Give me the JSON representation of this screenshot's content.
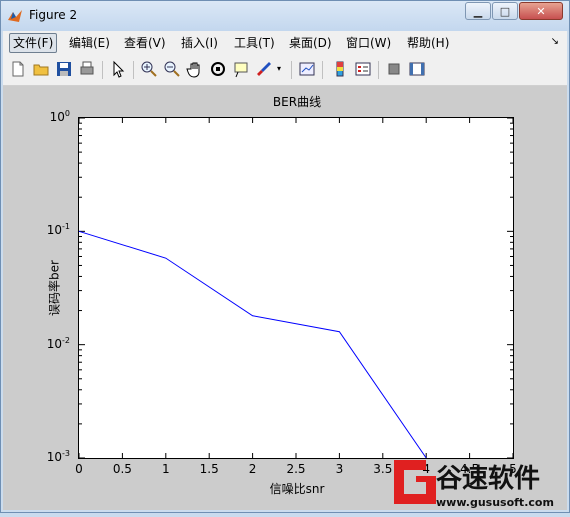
{
  "window": {
    "title": "Figure 2",
    "min_icon": "minimize-icon",
    "max_icon": "maximize-icon",
    "close_icon": "close-icon"
  },
  "menu": [
    {
      "label": "文件(F)",
      "active": true
    },
    {
      "label": "编辑(E)"
    },
    {
      "label": "查看(V)"
    },
    {
      "label": "插入(I)"
    },
    {
      "label": "工具(T)"
    },
    {
      "label": "桌面(D)"
    },
    {
      "label": "窗口(W)"
    },
    {
      "label": "帮助(H)"
    }
  ],
  "toolbar": [
    "new-file-icon",
    "open-folder-icon",
    "save-icon",
    "print-icon",
    "pointer-icon",
    "zoom-in-icon",
    "zoom-out-icon",
    "pan-hand-icon",
    "rotate-3d-icon",
    "data-cursor-icon",
    "brush-icon",
    "link-plot-icon",
    "colorbar-icon",
    "legend-icon",
    "hide-plot-tools-icon",
    "show-plot-tools-icon"
  ],
  "chart_data": {
    "type": "line",
    "title": "BER曲线",
    "xlabel": "信噪比snr",
    "ylabel": "误码率ber",
    "xlim": [
      0,
      5
    ],
    "ylim": [
      0.001,
      1
    ],
    "yscale": "log",
    "grid": false,
    "x": [
      0,
      1,
      2,
      3,
      4
    ],
    "series": [
      {
        "values": [
          0.1,
          0.058,
          0.018,
          0.013,
          0.001
        ],
        "color": "#0000ff"
      }
    ],
    "xticks": [
      "0",
      "0.5",
      "1",
      "1.5",
      "2",
      "2.5",
      "3",
      "3.5",
      "4",
      "4.5",
      "5"
    ],
    "yticks": [
      {
        "base": "10",
        "exp": "0"
      },
      {
        "base": "10",
        "exp": "-1"
      },
      {
        "base": "10",
        "exp": "-2"
      },
      {
        "base": "10",
        "exp": "-3"
      }
    ]
  },
  "watermark": {
    "brand": "谷速软件",
    "url": "www.gususoft.com",
    "color": "#e02020"
  }
}
